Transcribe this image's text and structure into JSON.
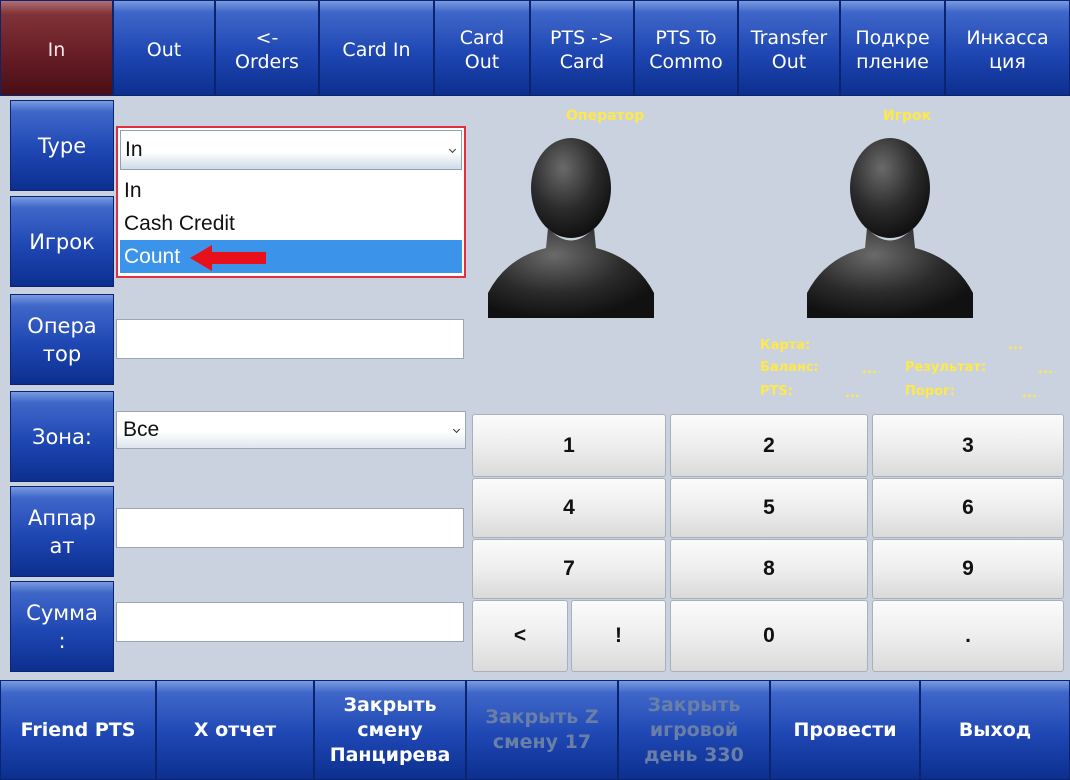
{
  "top_tabs": [
    {
      "label": "In",
      "active": true
    },
    {
      "label": "Out"
    },
    {
      "label": "<-\nOrders"
    },
    {
      "label": "Card In"
    },
    {
      "label": "Card\nOut"
    },
    {
      "label": "PTS ->\nCard"
    },
    {
      "label": "PTS To\nCommo"
    },
    {
      "label": "Transfer\nOut"
    },
    {
      "label": "Подкре\nпление"
    },
    {
      "label": "Инкасса\nция"
    }
  ],
  "left_buttons": [
    {
      "label": "Type"
    },
    {
      "label": "Игрок"
    },
    {
      "label": "Опера\nтор"
    },
    {
      "label": "Зона:"
    },
    {
      "label": "Аппар\nат"
    },
    {
      "label": "Сумма\n:"
    }
  ],
  "type_select": {
    "value": "In",
    "options": [
      "In",
      "Cash Credit",
      "Count"
    ],
    "highlighted": "Count"
  },
  "zona_select": {
    "value": "Все"
  },
  "operator_field": {
    "value": ""
  },
  "apparat_field": {
    "value": ""
  },
  "summa_field": {
    "value": ""
  },
  "avatars": {
    "operator_label": "Оператор",
    "player_label": "Игрок"
  },
  "player_info": {
    "card_label": "Карта:",
    "card_value": "...",
    "balance_label": "Баланс:",
    "balance_value": "...",
    "result_label": "Результат:",
    "result_value": "...",
    "pts_label": "PTS:",
    "pts_value": "...",
    "threshold_label": "Порог:",
    "threshold_value": "..."
  },
  "keypad": {
    "k1": "1",
    "k2": "2",
    "k3": "3",
    "k4": "4",
    "k5": "5",
    "k6": "6",
    "k7": "7",
    "k8": "8",
    "k9": "9",
    "back": "<",
    "bang": "!",
    "k0": "0",
    "dot": "."
  },
  "bottom_buttons": [
    {
      "label": "Friend PTS"
    },
    {
      "label": "X отчет"
    },
    {
      "label": "Закрыть\nсмену\nПанцирева"
    },
    {
      "label": "Закрыть Z\nсмену 17",
      "disabled": true
    },
    {
      "label": "Закрыть\nигровой\nдень 330",
      "disabled": true
    },
    {
      "label": "Провести"
    },
    {
      "label": "Выход"
    }
  ],
  "colors": {
    "accent_blue": "#1f47b3",
    "active_tab": "#651c24",
    "highlight": "#3c93ea",
    "label_yellow": "#ffe94a",
    "annotation_red": "#e8101a"
  }
}
